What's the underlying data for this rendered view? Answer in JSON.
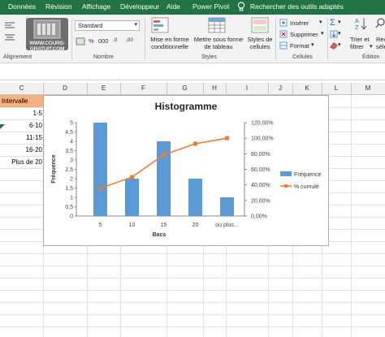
{
  "menu": {
    "tabs": [
      "Données",
      "Révision",
      "Affichage",
      "Développeur",
      "Aide",
      "Power Pivot",
      "Rechercher des outils adaptés"
    ]
  },
  "ribbon": {
    "watermark": "WWW.COURS-GRATUIT.COM",
    "alignment_label": "Alignement",
    "number_format": "Standard",
    "number_label": "Nombre",
    "number_symbols": [
      "%",
      "000",
      ",0",
      ",00"
    ],
    "styles": {
      "conditional": "Mise en forme conditionnelle",
      "table": "Mettre sous forme de tableau",
      "cell": "Styles de cellules",
      "label": "Styles"
    },
    "cells": {
      "insert": "Insérer",
      "delete": "Supprimer",
      "format": "Format",
      "label": "Cellules"
    },
    "edit": {
      "sort": "Trier et filtrer",
      "find_1": "Recl",
      "find_2": "séle",
      "label": "Édition"
    }
  },
  "columns": [
    "C",
    "D",
    "E",
    "F",
    "G",
    "H",
    "I",
    "J",
    "K",
    "L",
    "M"
  ],
  "cells": {
    "header": "Intervalle",
    "rows": [
      "1-5",
      "6-10",
      "11-15",
      "16-20",
      "Plus de 20"
    ]
  },
  "chart_data": {
    "type": "bar",
    "title": "Histogramme",
    "xlabel": "Bacs",
    "ylabel": "Fréquence",
    "categories": [
      "5",
      "10",
      "15",
      "20",
      "ou plus..."
    ],
    "series": [
      {
        "name": "Fréquence",
        "type": "bar",
        "values": [
          5,
          2,
          4,
          2,
          1
        ],
        "color": "#5b9bd5"
      },
      {
        "name": "% cumulé",
        "type": "line",
        "values": [
          35.71,
          50.0,
          78.57,
          92.86,
          100.0
        ],
        "color": "#ed7d31"
      }
    ],
    "ylim": [
      0,
      5
    ],
    "yticks": [
      "0",
      "0,5",
      "1",
      "1,5",
      "2",
      "2,5",
      "3",
      "3,5",
      "4",
      "4,5",
      "5"
    ],
    "y2lim": [
      0,
      120
    ],
    "y2ticks": [
      "0,00%",
      "20,00%",
      "40,00%",
      "60,00%",
      "80,00%",
      "100,00%",
      "120,00%"
    ],
    "legend": "right"
  }
}
